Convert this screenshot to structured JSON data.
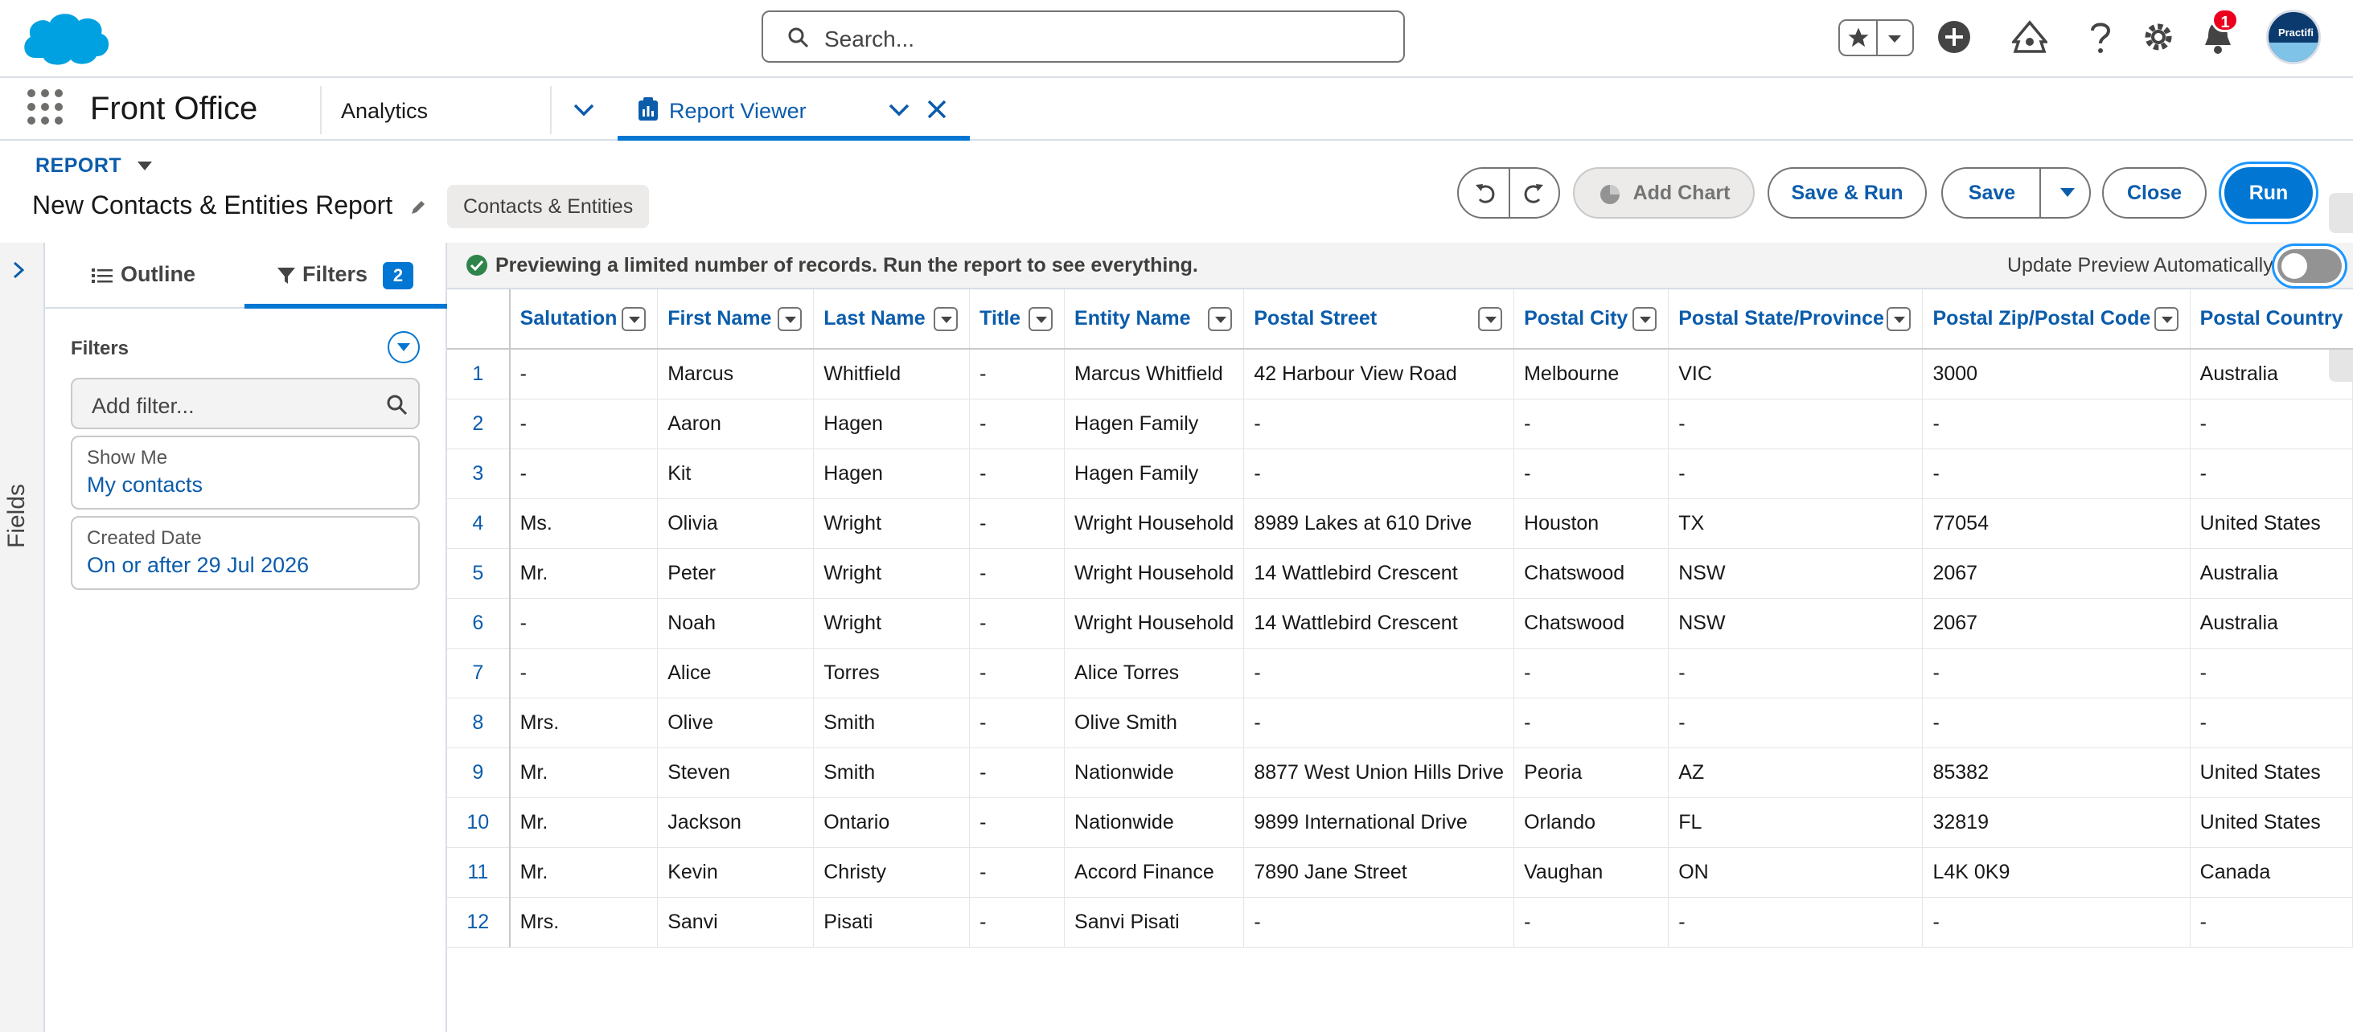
{
  "header": {
    "search_placeholder": "Search...",
    "notification_count": "1",
    "avatar_text": "Practifi"
  },
  "nav": {
    "app_name": "Front Office",
    "items": [
      "Analytics"
    ],
    "active_tab": "Report Viewer"
  },
  "report": {
    "type_label": "REPORT",
    "title": "New Contacts & Entities Report",
    "report_type_pill": "Contacts & Entities"
  },
  "toolbar": {
    "add_chart": "Add Chart",
    "save_run": "Save & Run",
    "save": "Save",
    "close": "Close",
    "run": "Run"
  },
  "side_rail": {
    "label": "Fields"
  },
  "panel": {
    "tab_outline": "Outline",
    "tab_filters": "Filters",
    "filters_count": "2",
    "filters_title": "Filters",
    "add_filter_placeholder": "Add filter...",
    "filters": [
      {
        "label": "Show Me",
        "value": "My contacts"
      },
      {
        "label": "Created Date",
        "value": "On or after 29 Jul 2026"
      }
    ]
  },
  "preview": {
    "message": "Previewing a limited number of records. Run the report to see everything.",
    "auto_update_label": "Update Preview Automatically",
    "auto_update_on": false
  },
  "table": {
    "columns": [
      "Salutation",
      "First Name",
      "Last Name",
      "Title",
      "Entity Name",
      "Postal Street",
      "Postal City",
      "Postal State/Province",
      "Postal Zip/Postal Code",
      "Postal Country"
    ],
    "rows": [
      [
        "1",
        "-",
        "Marcus",
        "Whitfield",
        "-",
        "Marcus Whitfield",
        "42 Harbour View Road",
        "Melbourne",
        "VIC",
        "3000",
        "Australia"
      ],
      [
        "2",
        "-",
        "Aaron",
        "Hagen",
        "-",
        "Hagen Family",
        "-",
        "-",
        "-",
        "-",
        "-"
      ],
      [
        "3",
        "-",
        "Kit",
        "Hagen",
        "-",
        "Hagen Family",
        "-",
        "-",
        "-",
        "-",
        "-"
      ],
      [
        "4",
        "Ms.",
        "Olivia",
        "Wright",
        "-",
        "Wright Household",
        "8989 Lakes at 610 Drive",
        "Houston",
        "TX",
        "77054",
        "United States"
      ],
      [
        "5",
        "Mr.",
        "Peter",
        "Wright",
        "-",
        "Wright Household",
        "14 Wattlebird Crescent",
        "Chatswood",
        "NSW",
        "2067",
        "Australia"
      ],
      [
        "6",
        "-",
        "Noah",
        "Wright",
        "-",
        "Wright Household",
        "14 Wattlebird Crescent",
        "Chatswood",
        "NSW",
        "2067",
        "Australia"
      ],
      [
        "7",
        "-",
        "Alice",
        "Torres",
        "-",
        "Alice Torres",
        "-",
        "-",
        "-",
        "-",
        "-"
      ],
      [
        "8",
        "Mrs.",
        "Olive",
        "Smith",
        "-",
        "Olive Smith",
        "-",
        "-",
        "-",
        "-",
        "-"
      ],
      [
        "9",
        "Mr.",
        "Steven",
        "Smith",
        "-",
        "Nationwide",
        "8877 West Union Hills Drive",
        "Peoria",
        "AZ",
        "85382",
        "United States"
      ],
      [
        "10",
        "Mr.",
        "Jackson",
        "Ontario",
        "-",
        "Nationwide",
        "9899 International Drive",
        "Orlando",
        "FL",
        "32819",
        "United States"
      ],
      [
        "11",
        "Mr.",
        "Kevin",
        "Christy",
        "-",
        "Accord Finance",
        "7890 Jane Street",
        "Vaughan",
        "ON",
        "L4K 0K9",
        "Canada"
      ],
      [
        "12",
        "Mrs.",
        "Sanvi",
        "Pisati",
        "-",
        "Sanvi Pisati",
        "-",
        "-",
        "-",
        "-",
        "-"
      ]
    ]
  },
  "colors": {
    "brand": "#0176d3",
    "link": "#0b5cab",
    "success": "#2e844a",
    "alert": "#ea001e"
  }
}
